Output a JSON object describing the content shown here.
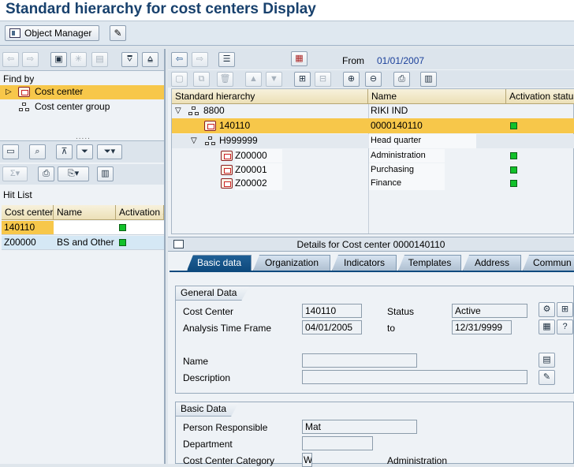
{
  "title": "Standard hierarchy for cost centers Display",
  "appbar": {
    "object_manager_label": "Object Manager"
  },
  "left": {
    "find_by_label": "Find by",
    "find_items": [
      "Cost center",
      "Cost center group"
    ],
    "hit_list_label": "Hit List",
    "hit_columns": [
      "Cost center",
      "Name",
      "Activation s"
    ],
    "hit_rows": [
      {
        "cost_center": "140110",
        "name": ""
      },
      {
        "cost_center": "Z00000",
        "name": "BS and Other"
      }
    ]
  },
  "right": {
    "from_label": "From",
    "from_value": "01/01/2007",
    "tree_columns": [
      "Standard hierarchy",
      "Name",
      "Activation status"
    ],
    "tree_rows": [
      {
        "node": "8800",
        "name": "RIKI IND"
      },
      {
        "node": "140110",
        "name": "0000140110"
      },
      {
        "node": "H999999",
        "name": "Head quarter"
      },
      {
        "node": "Z00000",
        "name": "Administration"
      },
      {
        "node": "Z00001",
        "name": "Purchasing"
      },
      {
        "node": "Z00002",
        "name": "Finance"
      }
    ],
    "details_title": "Details for Cost center 0000140110",
    "tabs": [
      "Basic data",
      "Organization",
      "Indicators",
      "Templates",
      "Address",
      "Commun"
    ],
    "general_data": {
      "title": "General Data",
      "cost_center_label": "Cost Center",
      "cost_center_value": "140110",
      "status_label": "Status",
      "status_value": "Active",
      "analysis_label": "Analysis Time Frame",
      "analysis_from": "04/01/2005",
      "to_label": "to",
      "analysis_to": "12/31/9999",
      "name_label": "Name",
      "name_value": "",
      "description_label": "Description",
      "description_value": ""
    },
    "basic_data": {
      "title": "Basic Data",
      "person_label": "Person Responsible",
      "person_value": "Mat",
      "department_label": "Department",
      "department_value": "",
      "category_label": "Cost Center Category",
      "category_value": "W",
      "category_text": "Administration"
    }
  },
  "colors": {
    "title": "#18416d",
    "selection": "#f7c74a",
    "active_tab": "#0e4a7e",
    "status_green": "#12c12a"
  },
  "icons": [
    "object-manager-icon",
    "toggle-edit-icon",
    "back-icon",
    "forward-icon",
    "hierarchy-icon",
    "calendar-icon",
    "expand-icon",
    "collapse-icon",
    "print-icon",
    "layout-icon",
    "filter-icon"
  ]
}
